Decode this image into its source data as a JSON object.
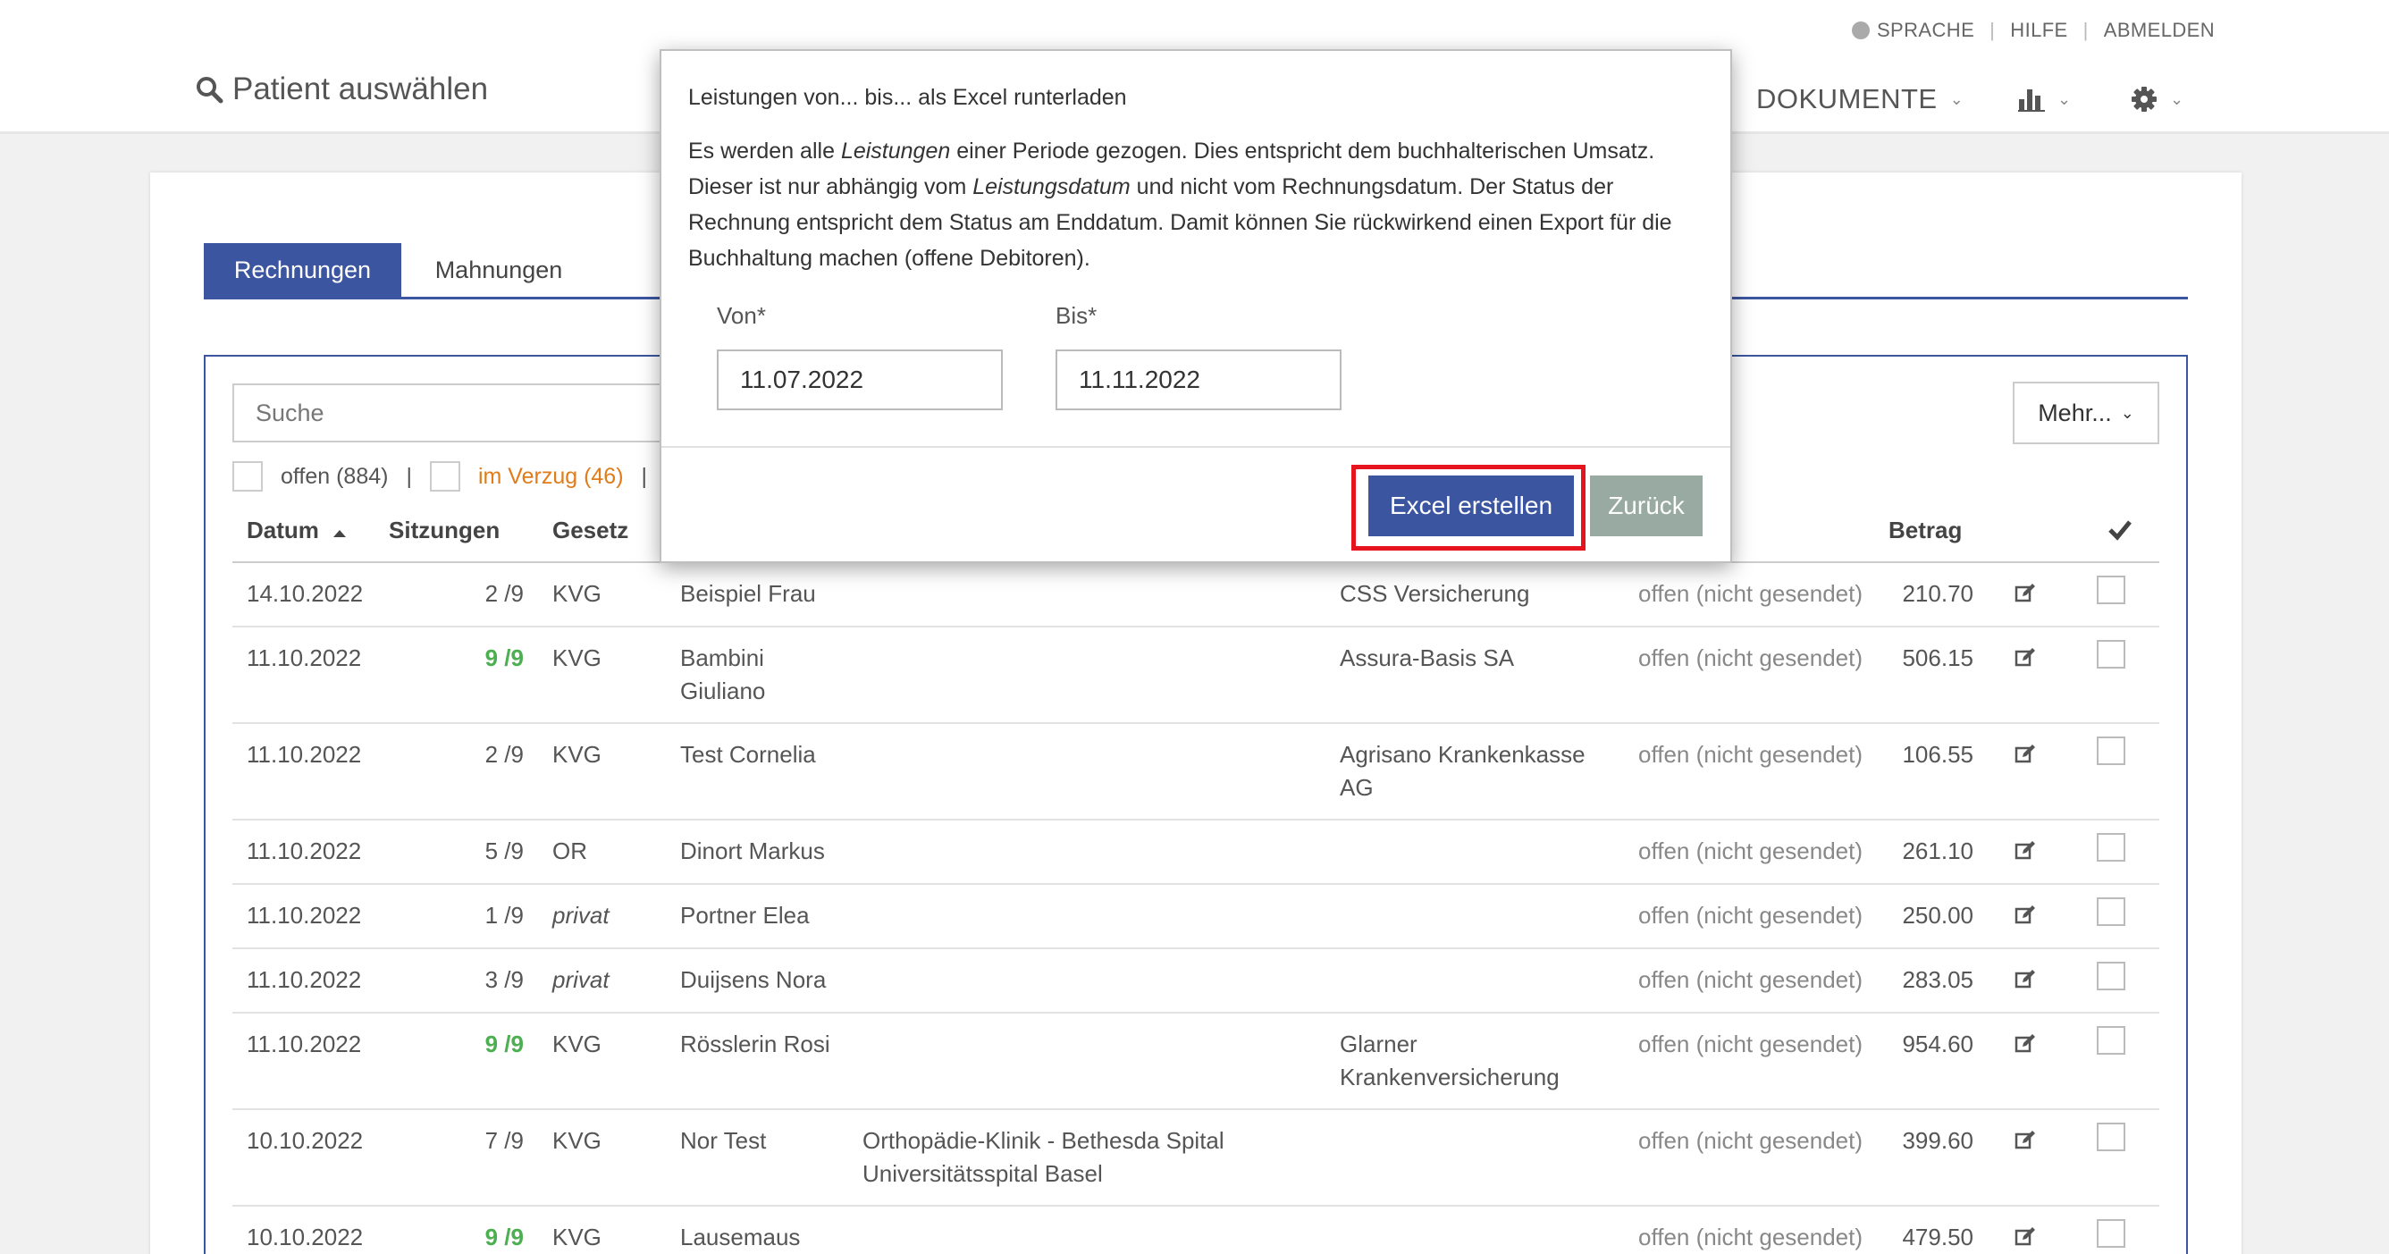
{
  "utility": {
    "language": "SPRACHE",
    "help": "HILFE",
    "logout": "ABMELDEN"
  },
  "header": {
    "patient_select": "Patient auswählen",
    "documents": "DOKUMENTE"
  },
  "tabs": [
    {
      "label": "Rechnungen"
    },
    {
      "label": "Mahnungen"
    }
  ],
  "toolbar": {
    "search_placeholder": "Suche",
    "more": "Mehr..."
  },
  "filters": {
    "open": "offen (884)",
    "separator": "|",
    "overdue": "im Verzug (46)"
  },
  "columns": {
    "date": "Datum",
    "sessions": "Sitzungen",
    "law": "Gesetz",
    "amount": "Betrag"
  },
  "rows": [
    {
      "date": "14.10.2022",
      "sessions": "2 /9",
      "law": "KVG",
      "patient": [
        "Beispiel Frau"
      ],
      "referrer": [],
      "insurer": [
        "CSS Versicherung"
      ],
      "status": "offen (nicht gesendet)",
      "amount": "210.70"
    },
    {
      "date": "11.10.2022",
      "sessions": "9 /9",
      "law": "KVG",
      "patient": [
        "Bambini",
        "Giuliano"
      ],
      "referrer": [],
      "insurer": [
        "Assura-Basis SA"
      ],
      "status": "offen (nicht gesendet)",
      "amount": "506.15"
    },
    {
      "date": "11.10.2022",
      "sessions": "2 /9",
      "law": "KVG",
      "patient": [
        "Test Cornelia"
      ],
      "referrer": [],
      "insurer": [
        "Agrisano Krankenkasse",
        "AG"
      ],
      "status": "offen (nicht gesendet)",
      "amount": "106.55"
    },
    {
      "date": "11.10.2022",
      "sessions": "5 /9",
      "law": "OR",
      "patient": [
        "Dinort Markus"
      ],
      "referrer": [],
      "insurer": [],
      "status": "offen (nicht gesendet)",
      "amount": "261.10"
    },
    {
      "date": "11.10.2022",
      "sessions": "1 /9",
      "law": "privat",
      "patient": [
        "Portner Elea"
      ],
      "referrer": [],
      "insurer": [],
      "status": "offen (nicht gesendet)",
      "amount": "250.00"
    },
    {
      "date": "11.10.2022",
      "sessions": "3 /9",
      "law": "privat",
      "patient": [
        "Duijsens Nora"
      ],
      "referrer": [],
      "insurer": [],
      "status": "offen (nicht gesendet)",
      "amount": "283.05"
    },
    {
      "date": "11.10.2022",
      "sessions": "9 /9",
      "law": "KVG",
      "patient": [
        "Rösslerin Rosi"
      ],
      "referrer": [],
      "insurer": [
        "Glarner",
        "Krankenversicherung"
      ],
      "status": "offen (nicht gesendet)",
      "amount": "954.60"
    },
    {
      "date": "10.10.2022",
      "sessions": "7 /9",
      "law": "KVG",
      "patient": [
        "Nor Test"
      ],
      "referrer": [
        "Orthopädie-Klinik - Bethesda Spital",
        "Universitätsspital Basel"
      ],
      "insurer": [],
      "status": "offen (nicht gesendet)",
      "amount": "399.60"
    },
    {
      "date": "10.10.2022",
      "sessions": "9 /9",
      "law": "KVG",
      "patient": [
        "Lausemaus"
      ],
      "referrer": [],
      "insurer": [],
      "status": "offen (nicht gesendet)",
      "amount": "479.50"
    }
  ],
  "modal": {
    "title": "Leistungen von... bis... als Excel runterladen",
    "text_parts": [
      {
        "t": "Es werden alle ",
        "i": false
      },
      {
        "t": "Leistungen",
        "i": true
      },
      {
        "t": " einer Periode gezogen. Dies entspricht dem buchhalterischen Umsatz. Dieser ist nur abhängig vom ",
        "i": false
      },
      {
        "t": "Leistungsdatum",
        "i": true
      },
      {
        "t": " und nicht vom Rechnungsdatum. Der Status der Rechnung entspricht dem Status am Enddatum. Damit können Sie rückwirkend einen Export für die Buchhaltung machen (offene Debitoren).",
        "i": false
      }
    ],
    "from_label": "Von*",
    "from_value": "11.07.2022",
    "to_label": "Bis*",
    "to_value": "11.11.2022",
    "create_button": "Excel erstellen",
    "back_button": "Zurück"
  },
  "colors": {
    "primary": "#3b55a0",
    "highlight": "#e5141f",
    "back_button": "#98aaa2",
    "overdue": "#e07c1a",
    "complete_sessions": "#4caf50"
  },
  "icons": [
    "globe-icon",
    "search-icon",
    "bar-chart-icon",
    "gear-icon",
    "chevron-down-icon",
    "sort-asc-icon",
    "checkmark-icon",
    "edit-icon"
  ]
}
